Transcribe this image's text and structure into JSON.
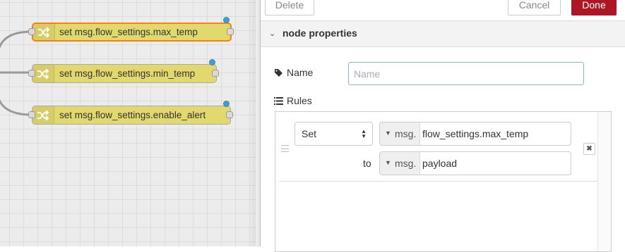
{
  "canvas": {
    "nodes": [
      {
        "label": "set msg.flow_settings.max_temp",
        "selected": true,
        "icon": "shuffle-icon"
      },
      {
        "label": "set msg.flow_settings.min_temp",
        "selected": false,
        "icon": "shuffle-icon"
      },
      {
        "label": "set msg.flow_settings.enable_alert",
        "selected": false,
        "icon": "shuffle-icon"
      }
    ],
    "colors": {
      "node_fill": "#e2d96e",
      "selected_border": "#ff7f0e",
      "status_dot": "#39a0d9"
    }
  },
  "panel": {
    "buttons": {
      "delete": "Delete",
      "cancel": "Cancel",
      "done": "Done"
    },
    "section_title": "node properties",
    "name_label": "Name",
    "name_placeholder": "Name",
    "name_value": "",
    "rules_label": "Rules",
    "rule": {
      "action": "Set",
      "target_prefix": "msg.",
      "target_value": "flow_settings.max_temp",
      "to_label": "to",
      "source_prefix": "msg.",
      "source_value": "payload",
      "remove_icon": "close-icon"
    },
    "colors": {
      "done_button": "#ad1625",
      "input_focus_border": "#85b7d9"
    }
  }
}
